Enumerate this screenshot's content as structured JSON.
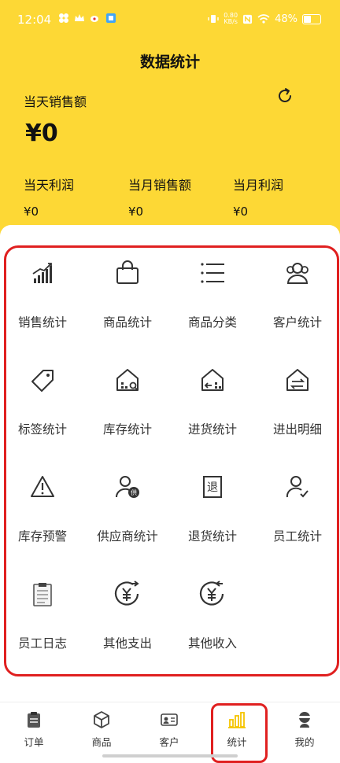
{
  "status": {
    "time": "12:04",
    "speed_top": "0.80",
    "speed_unit": "KB/s",
    "battery": "48%"
  },
  "header": {
    "title": "数据统计"
  },
  "summary": {
    "today_sales_label": "当天销售额",
    "today_sales_value": "¥0",
    "stats": [
      {
        "label": "当天利润",
        "value": "¥0"
      },
      {
        "label": "当月销售额",
        "value": "¥0"
      },
      {
        "label": "当月利润",
        "value": "¥0"
      }
    ]
  },
  "grid": [
    {
      "label": "销售统计",
      "icon": "sales-chart-icon"
    },
    {
      "label": "商品统计",
      "icon": "shopping-bag-icon"
    },
    {
      "label": "商品分类",
      "icon": "list-icon"
    },
    {
      "label": "客户统计",
      "icon": "users-icon"
    },
    {
      "label": "标签统计",
      "icon": "tag-icon"
    },
    {
      "label": "库存统计",
      "icon": "warehouse-search-icon"
    },
    {
      "label": "进货统计",
      "icon": "warehouse-in-icon"
    },
    {
      "label": "进出明细",
      "icon": "warehouse-transfer-icon"
    },
    {
      "label": "库存预警",
      "icon": "warning-icon"
    },
    {
      "label": "供应商统计",
      "icon": "supplier-icon"
    },
    {
      "label": "退货统计",
      "icon": "return-icon"
    },
    {
      "label": "员工统计",
      "icon": "employee-icon"
    },
    {
      "label": "员工日志",
      "icon": "clipboard-icon"
    },
    {
      "label": "其他支出",
      "icon": "yuan-out-icon"
    },
    {
      "label": "其他收入",
      "icon": "yuan-in-icon"
    }
  ],
  "tabs": [
    {
      "label": "订单",
      "icon": "order-icon"
    },
    {
      "label": "商品",
      "icon": "product-box-icon"
    },
    {
      "label": "客户",
      "icon": "customer-card-icon"
    },
    {
      "label": "统计",
      "icon": "stats-bars-icon",
      "active": true
    },
    {
      "label": "我的",
      "icon": "profile-icon"
    }
  ],
  "colors": {
    "header_bg": "#fdd835",
    "highlight": "#e02020",
    "active_tab": "#f5c400"
  }
}
